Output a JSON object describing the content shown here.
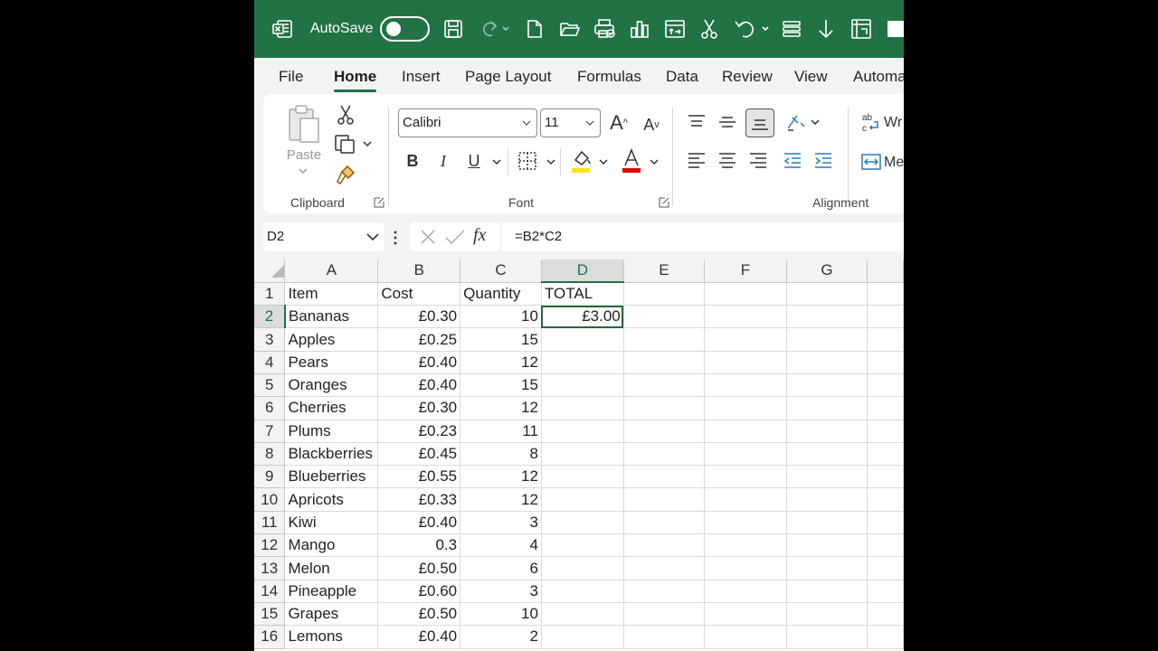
{
  "titlebar": {
    "autosave_label": "AutoSave"
  },
  "tabs": [
    "File",
    "Home",
    "Insert",
    "Page Layout",
    "Formulas",
    "Data",
    "Review",
    "View",
    "Automa"
  ],
  "active_tab": "Home",
  "ribbon": {
    "paste_label": "Paste",
    "clipboard_label": "Clipboard",
    "font_label": "Font",
    "alignment_label": "Alignment",
    "font_name": "Calibri",
    "font_size": "11",
    "wrap_label": "Wr",
    "merge_label": "Me",
    "font_color_accent": "#e00000",
    "fill_color_accent": "#ffe600"
  },
  "formula_bar": {
    "name_box": "D2",
    "fx_label": "fx",
    "formula": "=B2*C2"
  },
  "sheet": {
    "columns": [
      "A",
      "B",
      "C",
      "D",
      "E",
      "F",
      "G"
    ],
    "selected_column": "D",
    "selected_row": "2",
    "rows": [
      {
        "n": "1",
        "a": "Item",
        "b": "Cost",
        "c": "Quantity",
        "d": "TOTAL"
      },
      {
        "n": "2",
        "a": "Bananas",
        "b": "£0.30",
        "c": "10",
        "d": "£3.00"
      },
      {
        "n": "3",
        "a": "Apples",
        "b": "£0.25",
        "c": "15",
        "d": ""
      },
      {
        "n": "4",
        "a": "Pears",
        "b": "£0.40",
        "c": "12",
        "d": ""
      },
      {
        "n": "5",
        "a": "Oranges",
        "b": "£0.40",
        "c": "15",
        "d": ""
      },
      {
        "n": "6",
        "a": "Cherries",
        "b": "£0.30",
        "c": "12",
        "d": ""
      },
      {
        "n": "7",
        "a": "Plums",
        "b": "£0.23",
        "c": "11",
        "d": ""
      },
      {
        "n": "8",
        "a": "Blackberries",
        "b": "£0.45",
        "c": "8",
        "d": ""
      },
      {
        "n": "9",
        "a": "Blueberries",
        "b": "£0.55",
        "c": "12",
        "d": ""
      },
      {
        "n": "10",
        "a": "Apricots",
        "b": "£0.33",
        "c": "12",
        "d": ""
      },
      {
        "n": "11",
        "a": "Kiwi",
        "b": "£0.40",
        "c": "3",
        "d": ""
      },
      {
        "n": "12",
        "a": "Mango",
        "b": "0.3",
        "c": "4",
        "d": ""
      },
      {
        "n": "13",
        "a": "Melon",
        "b": "£0.50",
        "c": "6",
        "d": ""
      },
      {
        "n": "14",
        "a": "Pineapple",
        "b": "£0.60",
        "c": "3",
        "d": ""
      },
      {
        "n": "15",
        "a": "Grapes",
        "b": "£0.50",
        "c": "10",
        "d": ""
      },
      {
        "n": "16",
        "a": "Lemons",
        "b": "£0.40",
        "c": "2",
        "d": ""
      }
    ]
  }
}
